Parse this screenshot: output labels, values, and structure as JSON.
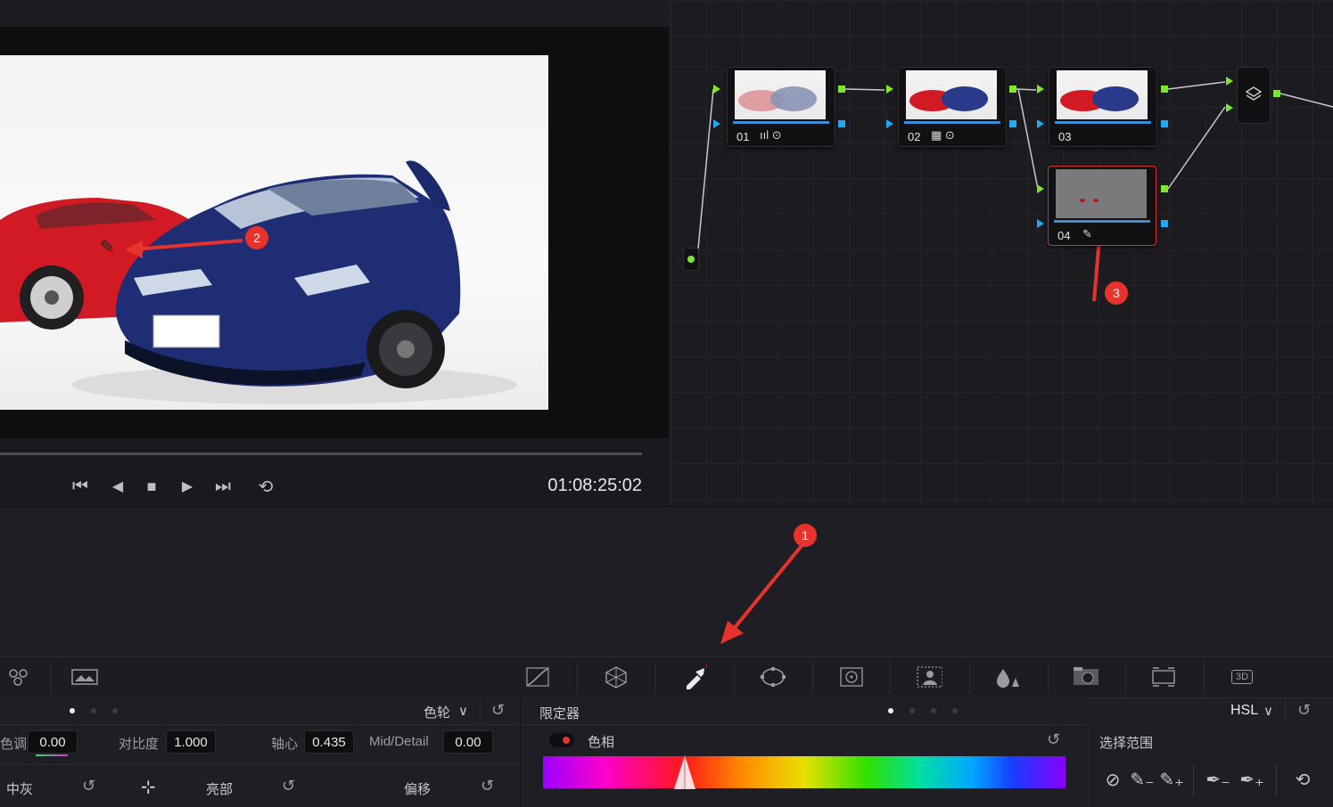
{
  "viewer": {
    "timecode": "01:08:25:02",
    "transport": {
      "first": "⏮",
      "prev": "◀",
      "stop": "■",
      "play": "▶",
      "last": "⏭",
      "loop": "⟲"
    },
    "image_plate": "",
    "eyedropper_glyph": "✎"
  },
  "nodes": [
    {
      "label": "01",
      "icons": "ııl ⊙"
    },
    {
      "label": "02",
      "icons": "▦ ⊙"
    },
    {
      "label": "03",
      "icons": ""
    },
    {
      "label": "04",
      "icons": "✎"
    }
  ],
  "annotations": [
    "1",
    "2",
    "3"
  ],
  "toolbar": {
    "icons": [
      "nodes-icon",
      "scene-icon",
      "curves-icon",
      "color-warper-icon",
      "qualifier-icon",
      "power-window-icon",
      "tracker-icon",
      "magic-mask-icon",
      "blur-icon",
      "key-icon",
      "sizing-icon",
      "3d-icon"
    ],
    "glyph_3d": "3D"
  },
  "left_panel": {
    "mode": "色轮",
    "mode_caret": "∨",
    "reset_glyph": "↺",
    "params": [
      {
        "label": "色调",
        "value": "0.00"
      },
      {
        "label": "对比度",
        "value": "1.000"
      },
      {
        "label": "轴心",
        "value": "0.435"
      },
      {
        "label": "Mid/Detail",
        "value": "0.00"
      }
    ],
    "wheels": [
      "中灰",
      "亮部",
      "偏移"
    ],
    "crosshair_glyph": "⊹"
  },
  "qualifier_panel": {
    "title": "限定器",
    "mode": "HSL",
    "mode_caret": "∨",
    "reset_glyph": "↺",
    "hue_label": "色相"
  },
  "selection_panel": {
    "title": "选择范围",
    "tools": [
      "⊘",
      "✎₋",
      "✎₊",
      "✒₋",
      "✒₊",
      "⟲"
    ]
  },
  "colors": {
    "accent_red": "#e8322c",
    "port_green": "#7ee62d",
    "port_blue": "#23a7f0",
    "selected_node_border": "#d9342b"
  }
}
